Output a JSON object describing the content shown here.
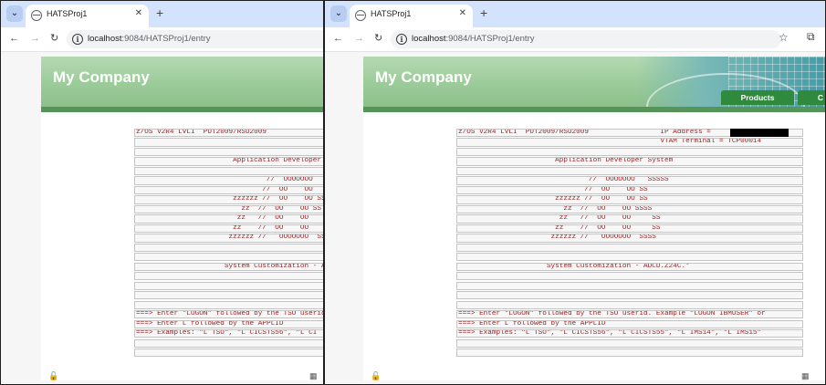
{
  "tab": {
    "title": "HATSProj1",
    "close": "✕",
    "new_tab": "+",
    "list_button": "⌄"
  },
  "nav": {
    "back": "←",
    "forward": "→",
    "reload": "↻",
    "info": "i"
  },
  "address": {
    "host": "localhost",
    "rest": ":9084/HATSProj1/entry"
  },
  "right_toolbar": {
    "star": "☆",
    "extensions": "⧉"
  },
  "banner": {
    "company": "My Company",
    "tabs": [
      "Products",
      "C"
    ]
  },
  "left_screen": [
    "z/OS V2R4 LVLI  PUT2009/RSU2009",
    "",
    "",
    "                       Application Developer",
    "",
    "                               //  OOOOOOO",
    "                              //  OO    OO",
    "                       zzzzzz //  OO    OO SS",
    "                         zz  //  OO    OO SS",
    "                        zz   //  OO    OO",
    "                       zz    //  OO    OO",
    "                      zzzzzz //   OOOOOOO  SSSS",
    "",
    "",
    "                     System Customization - AD",
    "",
    "",
    "",
    "",
    "===> Enter \"LOGON\" followed by the TSO userid",
    "===> Enter L followed by the APPLID",
    "===> Examples: \"L TSO\", \"L CICSTS56\", \"L CI",
    "",
    ""
  ],
  "right_screen": [
    "z/OS V2R4 LVLI  PUT2009/RSU2009                 IP Address = ",
    "                                                VTAM Terminal = TCP00014",
    "",
    "                       Application Developer System",
    "",
    "                               //  OOOOOOO   SSSSS",
    "                              //  OO    OO SS",
    "                       zzzzzz //  OO    OO SS",
    "                         zz  //  OO    OO SSSS",
    "                        zz   //  OO    OO     SS",
    "                       zz    //  OO    OO     SS",
    "                      zzzzzz //   OOOOOOO  SSSS",
    "",
    "",
    "                     System Customization - ADCD.Z24C.*",
    "",
    "",
    "",
    "",
    "===> Enter \"LOGON\" followed by the TSO userid. Example \"LOGON IBMUSER\" or",
    "===> Enter L followed by the APPLID",
    "===> Examples: \"L TSO\", \"L CICSTS56\", \"L CICSTS55\", \"L IMS14\", \"L IMS15\"",
    "",
    ""
  ],
  "footer": {
    "left_icon": "🔓",
    "right_icon": "▦"
  }
}
